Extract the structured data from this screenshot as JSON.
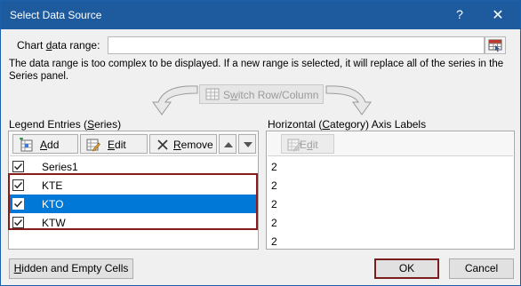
{
  "window": {
    "title": "Select Data Source",
    "help_glyph": "?",
    "close_glyph": "✕"
  },
  "chart_range": {
    "label_pre": "Chart ",
    "label_accel": "d",
    "label_post": "ata range:",
    "value": ""
  },
  "message": "The data range is too complex to be displayed. If a new range is selected, it will replace all of the series in the Series panel.",
  "switch_button": {
    "label_pre": "S",
    "label_accel": "w",
    "label_post": "itch Row/Column"
  },
  "legend": {
    "title_pre": "Legend Entries (",
    "title_accel": "S",
    "title_post": "eries)",
    "add": {
      "accel": "A",
      "rest": "dd"
    },
    "edit": {
      "accel": "E",
      "rest": "dit"
    },
    "remove": {
      "accel": "R",
      "rest": "emove"
    },
    "series": [
      {
        "name": "Series1",
        "checked": true,
        "selected": false
      },
      {
        "name": "KTE",
        "checked": true,
        "selected": false
      },
      {
        "name": "KTO",
        "checked": true,
        "selected": true
      },
      {
        "name": "KTW",
        "checked": true,
        "selected": false
      }
    ]
  },
  "axis": {
    "title_pre": "Horizontal (",
    "title_accel": "C",
    "title_post": "ategory) Axis Labels",
    "edit": {
      "accel": "d",
      "pre": "E",
      "rest": "it"
    },
    "labels": [
      "2",
      "2",
      "2",
      "2",
      "2"
    ]
  },
  "buttons": {
    "hidden_cells": {
      "accel": "H",
      "rest": "idden and Empty Cells"
    },
    "ok": "OK",
    "cancel": "Cancel"
  },
  "icons": {
    "range_picker": "range-select-icon",
    "switch": "switch-row-column-icon",
    "add": "add-series-icon",
    "edit": "edit-icon",
    "remove": "remove-x-icon",
    "move_up": "move-up-icon",
    "move_down": "move-down-icon",
    "checkbox": "checkmark-icon"
  },
  "colors": {
    "title_bar": "#1e5b9e",
    "selection": "#0078d7",
    "highlight_border": "#8b1a1a"
  }
}
